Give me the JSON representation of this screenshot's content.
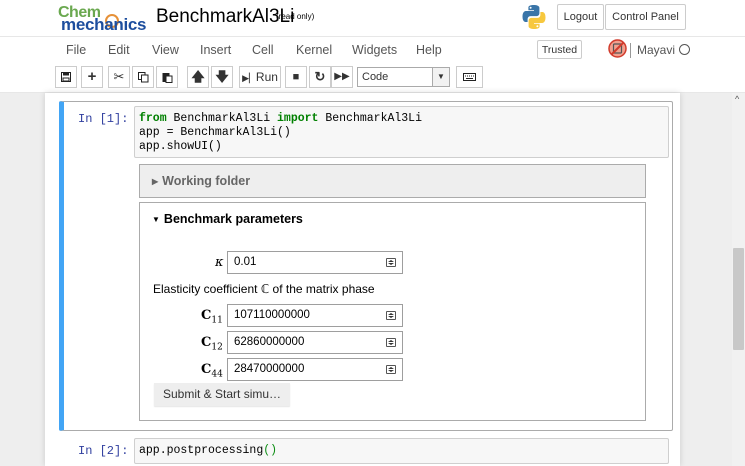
{
  "header": {
    "logo_line1": "Chem",
    "logo_line2": "mechanics",
    "notebook_name": "BenchmarkAl3Li",
    "readonly_label": "(read only)",
    "logout_label": "Logout",
    "control_panel_label": "Control Panel"
  },
  "menubar": {
    "items": [
      "File",
      "Edit",
      "View",
      "Insert",
      "Cell",
      "Kernel",
      "Widgets",
      "Help"
    ],
    "trusted_label": "Trusted",
    "kernel_name": "Mayavi"
  },
  "toolbar": {
    "run_label": "Run",
    "cell_type": "Code"
  },
  "cells": [
    {
      "prompt": "In [1]:",
      "code_kw_from": "from",
      "code_mod": " BenchmarkAl3Li ",
      "code_kw_import": "import",
      "code_cls": " BenchmarkAl3Li",
      "code_line2": "app = BenchmarkAl3Li()",
      "code_line3": "app.showUI()"
    },
    {
      "prompt": "In [2]:",
      "code_fn": "app.postprocessing",
      "code_parens": "()"
    }
  ],
  "widgets": {
    "working_folder_title": "Working folder",
    "benchmark_title": "Benchmark parameters",
    "kappa_symbol": "κ",
    "kappa_value": "0.01",
    "elasticity_label": "Elasticity coefficient ℂ of the matrix phase",
    "c11_symbol": "C",
    "c11_sub": "11",
    "c11_value": "107110000000",
    "c12_symbol": "C",
    "c12_sub": "12",
    "c12_value": "62860000000",
    "c44_symbol": "C",
    "c44_sub": "44",
    "c44_value": "28470000000",
    "submit_label": "Submit & Start simu…"
  },
  "colors": {
    "selected_cell_border": "#42a5f5",
    "prompt": "#303f9f",
    "keyword": "#008000"
  }
}
